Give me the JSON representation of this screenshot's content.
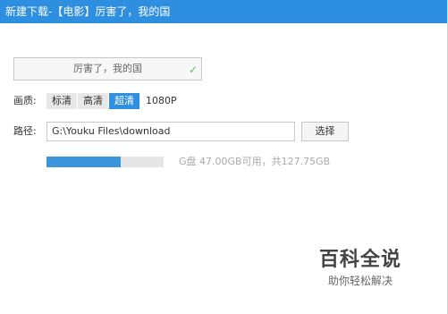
{
  "window": {
    "title": "新建下载-【电影】厉害了，我的国"
  },
  "form": {
    "name_value": "厉害了，我的国",
    "quality_label": "画质:",
    "quality_options": [
      "标清",
      "高清",
      "超清",
      "1080P"
    ],
    "quality_selected": "超清",
    "path_label": "路径:",
    "path_value": "G:\\Youku Files\\download",
    "choose_button": "选择",
    "disk_info": "G盘 47.00GB可用，共127.75GB",
    "disk_used_fraction": 0.632
  },
  "watermark": {
    "title": "百科全说",
    "subtitle": "助你轻松解决"
  },
  "colors": {
    "titlebar": "#2e8ee0",
    "accent": "#2f8fe0",
    "progress": "#3a95dc"
  }
}
